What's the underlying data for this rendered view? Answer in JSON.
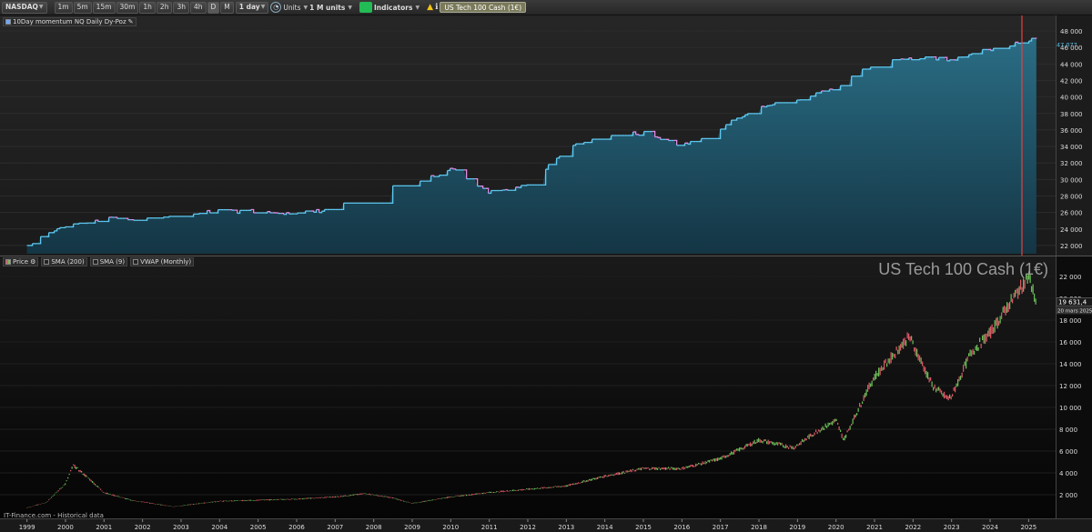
{
  "toolbar": {
    "market": "NASDAQ",
    "timeframes": [
      "1m",
      "5m",
      "15m",
      "30m",
      "1h",
      "2h",
      "3h",
      "4h",
      "D",
      "M"
    ],
    "active_timeframe": "D",
    "period": "1 day",
    "units_label": "Units",
    "units_value": "1 M units",
    "indicators_label": "Indicators",
    "instrument_tag": "US Tech 100 Cash (1€)"
  },
  "top_pane": {
    "legend": "10Day momentum NQ Daily Dy-Poz",
    "current_value": "47 077",
    "colors": {
      "fill_top": "#2a6d85",
      "fill_bottom": "#143544",
      "line_up": "#5ec8f0",
      "line_down": "#e58ae8",
      "cursor": "#e8403c"
    }
  },
  "bottom_pane": {
    "legend_items": [
      "Price",
      "SMA (200)",
      "SMA (9)",
      "VWAP (Monthly)"
    ],
    "watermark": "US Tech 100 Cash (1€)",
    "last_price": "19 631,4",
    "last_date": "20 mars 2025",
    "source": "IT-Finance.com - Historical data",
    "colors": {
      "up": "#6ec05a",
      "down": "#e05a6a"
    }
  },
  "chart_data": [
    {
      "type": "area",
      "title": "10Day momentum NQ Daily Dy-Poz",
      "x": [
        1999,
        2000,
        2001,
        2002,
        2003,
        2004,
        2005,
        2006,
        2007,
        2008,
        2009,
        2010,
        2011,
        2012,
        2013,
        2014,
        2015,
        2016,
        2017,
        2018,
        2019,
        2020,
        2021,
        2022,
        2023,
        2024,
        2025.2
      ],
      "values": [
        22000,
        24500,
        25200,
        25300,
        25800,
        26100,
        26200,
        25800,
        26500,
        28500,
        29500,
        31300,
        28500,
        29300,
        33800,
        35500,
        35600,
        34200,
        36200,
        38900,
        39500,
        41300,
        44000,
        44800,
        44600,
        45800,
        47077
      ],
      "ylim": [
        21000,
        49000
      ],
      "y_ticks": [
        22000,
        24000,
        26000,
        28000,
        30000,
        32000,
        34000,
        36000,
        38000,
        40000,
        42000,
        44000,
        46000,
        48000
      ],
      "y_tick_labels": [
        "22 000",
        "24 000",
        "26 000",
        "28 000",
        "30 000",
        "32 000",
        "34 000",
        "36 000",
        "38 000",
        "40 000",
        "42 000",
        "44 000",
        "46 000",
        "48 000"
      ]
    },
    {
      "type": "line",
      "title": "US Tech 100 Cash (1€)",
      "x": [
        1999,
        1999.5,
        2000,
        2000.2,
        2000.6,
        2001,
        2001.7,
        2002.8,
        2003.5,
        2004,
        2005,
        2006,
        2007,
        2007.8,
        2008.5,
        2009,
        2010,
        2011,
        2012,
        2013,
        2014,
        2015,
        2016,
        2017,
        2018,
        2018.9,
        2019.5,
        2020,
        2020.2,
        2020.8,
        2021,
        2021.9,
        2022.5,
        2022.9,
        2023,
        2023.5,
        2024,
        2024.5,
        2025,
        2025.2
      ],
      "values": [
        800,
        1300,
        3000,
        4700,
        3500,
        2200,
        1500,
        900,
        1200,
        1400,
        1500,
        1600,
        1800,
        2100,
        1700,
        1200,
        1800,
        2200,
        2500,
        2800,
        3700,
        4400,
        4400,
        5300,
        7000,
        6300,
        7800,
        8800,
        7000,
        11500,
        12800,
        16500,
        12000,
        10800,
        11000,
        15000,
        16800,
        19500,
        22000,
        19631
      ],
      "ylim": [
        0,
        23000
      ],
      "y_ticks": [
        2000,
        4000,
        6000,
        8000,
        10000,
        12000,
        14000,
        16000,
        18000,
        20000,
        22000
      ],
      "y_tick_labels": [
        "2 000",
        "4 000",
        "6 000",
        "8 000",
        "10 000",
        "12 000",
        "14 000",
        "16 000",
        "18 000",
        "20 000",
        "22 000"
      ]
    }
  ],
  "x_axis": {
    "tick_years": [
      1999,
      2000,
      2001,
      2002,
      2003,
      2004,
      2005,
      2006,
      2007,
      2008,
      2009,
      2010,
      2011,
      2012,
      2013,
      2014,
      2015,
      2016,
      2017,
      2018,
      2019,
      2020,
      2021,
      2022,
      2023,
      2024,
      2025
    ],
    "tick_labels": [
      "1999",
      "2000",
      "2001",
      "2002",
      "2003",
      "2004",
      "2005",
      "2006",
      "2007",
      "2008",
      "2009",
      "2010",
      "2011",
      "2012",
      "2013",
      "2014",
      "2015",
      "2016",
      "2017",
      "2018",
      "2019",
      "2020",
      "2021",
      "2022",
      "2023",
      "2024",
      "2025"
    ],
    "range": [
      1998.3,
      2025.7
    ]
  }
}
